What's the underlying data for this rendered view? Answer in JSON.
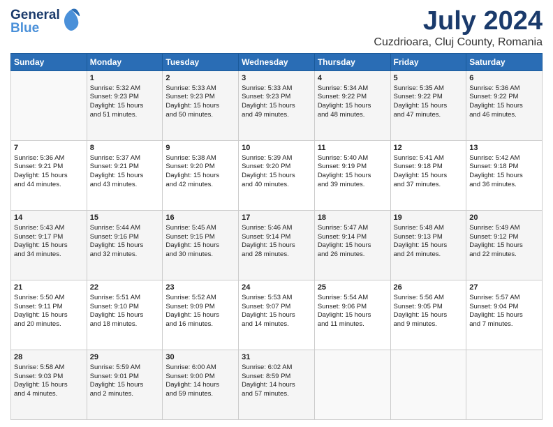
{
  "header": {
    "logo_line1": "General",
    "logo_line2": "Blue",
    "title": "July 2024",
    "subtitle": "Cuzdrioara, Cluj County, Romania"
  },
  "calendar": {
    "weekdays": [
      "Sunday",
      "Monday",
      "Tuesday",
      "Wednesday",
      "Thursday",
      "Friday",
      "Saturday"
    ],
    "rows": [
      [
        {
          "day": "",
          "content": ""
        },
        {
          "day": "1",
          "content": "Sunrise: 5:32 AM\nSunset: 9:23 PM\nDaylight: 15 hours\nand 51 minutes."
        },
        {
          "day": "2",
          "content": "Sunrise: 5:33 AM\nSunset: 9:23 PM\nDaylight: 15 hours\nand 50 minutes."
        },
        {
          "day": "3",
          "content": "Sunrise: 5:33 AM\nSunset: 9:23 PM\nDaylight: 15 hours\nand 49 minutes."
        },
        {
          "day": "4",
          "content": "Sunrise: 5:34 AM\nSunset: 9:22 PM\nDaylight: 15 hours\nand 48 minutes."
        },
        {
          "day": "5",
          "content": "Sunrise: 5:35 AM\nSunset: 9:22 PM\nDaylight: 15 hours\nand 47 minutes."
        },
        {
          "day": "6",
          "content": "Sunrise: 5:36 AM\nSunset: 9:22 PM\nDaylight: 15 hours\nand 46 minutes."
        }
      ],
      [
        {
          "day": "7",
          "content": "Sunrise: 5:36 AM\nSunset: 9:21 PM\nDaylight: 15 hours\nand 44 minutes."
        },
        {
          "day": "8",
          "content": "Sunrise: 5:37 AM\nSunset: 9:21 PM\nDaylight: 15 hours\nand 43 minutes."
        },
        {
          "day": "9",
          "content": "Sunrise: 5:38 AM\nSunset: 9:20 PM\nDaylight: 15 hours\nand 42 minutes."
        },
        {
          "day": "10",
          "content": "Sunrise: 5:39 AM\nSunset: 9:20 PM\nDaylight: 15 hours\nand 40 minutes."
        },
        {
          "day": "11",
          "content": "Sunrise: 5:40 AM\nSunset: 9:19 PM\nDaylight: 15 hours\nand 39 minutes."
        },
        {
          "day": "12",
          "content": "Sunrise: 5:41 AM\nSunset: 9:18 PM\nDaylight: 15 hours\nand 37 minutes."
        },
        {
          "day": "13",
          "content": "Sunrise: 5:42 AM\nSunset: 9:18 PM\nDaylight: 15 hours\nand 36 minutes."
        }
      ],
      [
        {
          "day": "14",
          "content": "Sunrise: 5:43 AM\nSunset: 9:17 PM\nDaylight: 15 hours\nand 34 minutes."
        },
        {
          "day": "15",
          "content": "Sunrise: 5:44 AM\nSunset: 9:16 PM\nDaylight: 15 hours\nand 32 minutes."
        },
        {
          "day": "16",
          "content": "Sunrise: 5:45 AM\nSunset: 9:15 PM\nDaylight: 15 hours\nand 30 minutes."
        },
        {
          "day": "17",
          "content": "Sunrise: 5:46 AM\nSunset: 9:14 PM\nDaylight: 15 hours\nand 28 minutes."
        },
        {
          "day": "18",
          "content": "Sunrise: 5:47 AM\nSunset: 9:14 PM\nDaylight: 15 hours\nand 26 minutes."
        },
        {
          "day": "19",
          "content": "Sunrise: 5:48 AM\nSunset: 9:13 PM\nDaylight: 15 hours\nand 24 minutes."
        },
        {
          "day": "20",
          "content": "Sunrise: 5:49 AM\nSunset: 9:12 PM\nDaylight: 15 hours\nand 22 minutes."
        }
      ],
      [
        {
          "day": "21",
          "content": "Sunrise: 5:50 AM\nSunset: 9:11 PM\nDaylight: 15 hours\nand 20 minutes."
        },
        {
          "day": "22",
          "content": "Sunrise: 5:51 AM\nSunset: 9:10 PM\nDaylight: 15 hours\nand 18 minutes."
        },
        {
          "day": "23",
          "content": "Sunrise: 5:52 AM\nSunset: 9:09 PM\nDaylight: 15 hours\nand 16 minutes."
        },
        {
          "day": "24",
          "content": "Sunrise: 5:53 AM\nSunset: 9:07 PM\nDaylight: 15 hours\nand 14 minutes."
        },
        {
          "day": "25",
          "content": "Sunrise: 5:54 AM\nSunset: 9:06 PM\nDaylight: 15 hours\nand 11 minutes."
        },
        {
          "day": "26",
          "content": "Sunrise: 5:56 AM\nSunset: 9:05 PM\nDaylight: 15 hours\nand 9 minutes."
        },
        {
          "day": "27",
          "content": "Sunrise: 5:57 AM\nSunset: 9:04 PM\nDaylight: 15 hours\nand 7 minutes."
        }
      ],
      [
        {
          "day": "28",
          "content": "Sunrise: 5:58 AM\nSunset: 9:03 PM\nDaylight: 15 hours\nand 4 minutes."
        },
        {
          "day": "29",
          "content": "Sunrise: 5:59 AM\nSunset: 9:01 PM\nDaylight: 15 hours\nand 2 minutes."
        },
        {
          "day": "30",
          "content": "Sunrise: 6:00 AM\nSunset: 9:00 PM\nDaylight: 14 hours\nand 59 minutes."
        },
        {
          "day": "31",
          "content": "Sunrise: 6:02 AM\nSunset: 8:59 PM\nDaylight: 14 hours\nand 57 minutes."
        },
        {
          "day": "",
          "content": ""
        },
        {
          "day": "",
          "content": ""
        },
        {
          "day": "",
          "content": ""
        }
      ]
    ]
  }
}
